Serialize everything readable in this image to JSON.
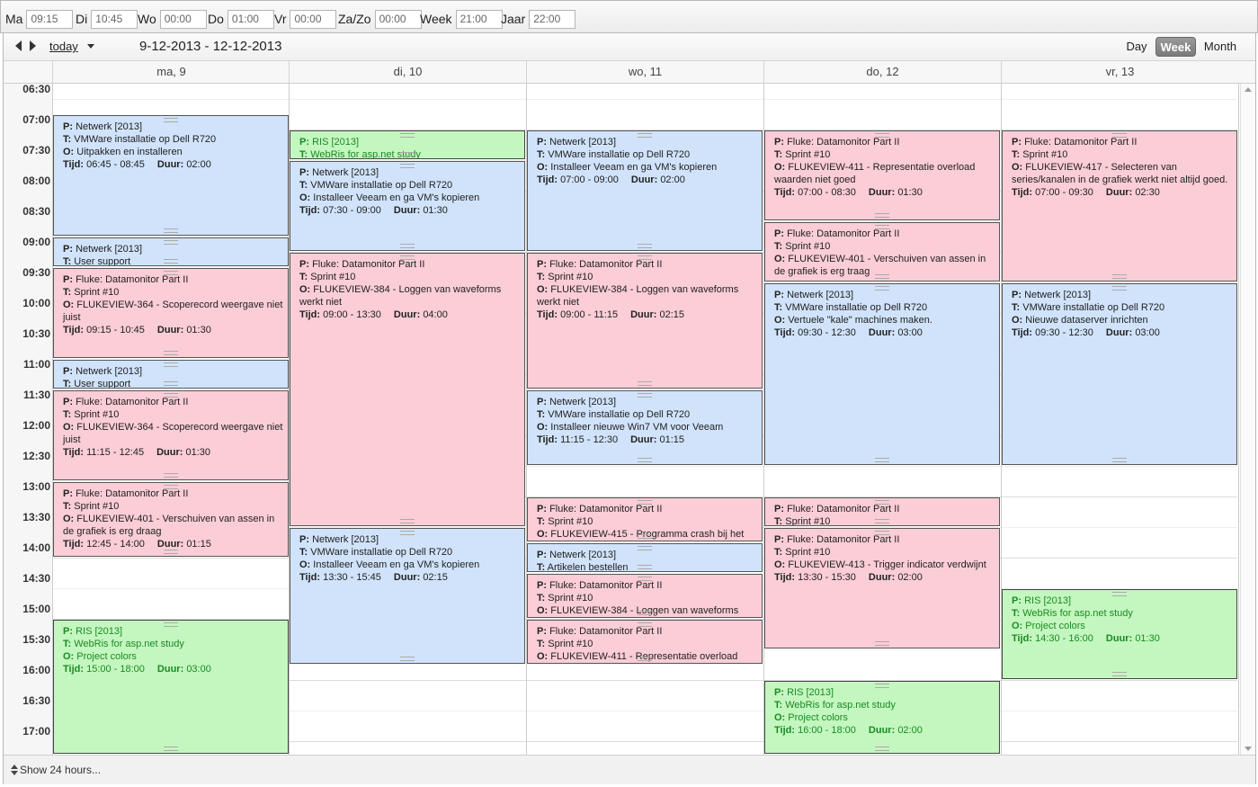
{
  "topbar": [
    {
      "label": "Ma",
      "value": "09:15"
    },
    {
      "label": "Di",
      "value": "10:45"
    },
    {
      "label": "Wo",
      "value": "00:00"
    },
    {
      "label": "Do",
      "value": "01:00"
    },
    {
      "label": "Vr",
      "value": "00:00"
    },
    {
      "label": "Za/Zo",
      "value": "00:00"
    },
    {
      "label": "Week",
      "value": "21:00"
    },
    {
      "label": "Jaar",
      "value": "22:00"
    }
  ],
  "nav": {
    "today": "today",
    "date_range": "9-12-2013 - 12-12-2013",
    "views": {
      "day": "Day",
      "week": "Week",
      "month": "Month"
    },
    "active_view": "Week"
  },
  "days": [
    "ma, 9",
    "di, 10",
    "wo, 11",
    "do, 12",
    "vr, 13"
  ],
  "times": [
    "06:30",
    "07:00",
    "07:30",
    "08:00",
    "08:30",
    "09:00",
    "09:30",
    "10:00",
    "10:30",
    "11:00",
    "11:30",
    "12:00",
    "12:30",
    "13:00",
    "13:30",
    "14:00",
    "14:30",
    "15:00",
    "15:30",
    "16:00",
    "16:30",
    "17:00"
  ],
  "events": [
    {
      "day": 0,
      "start": "06:45",
      "end": "08:45",
      "color": "blue",
      "lines": [
        [
          "P:",
          "Netwerk [2013]"
        ],
        [
          "T:",
          "VMWare installatie op Dell R720"
        ],
        [
          "O:",
          "Uitpakken en installeren"
        ],
        [
          "Tijd:",
          "06:45 - 08:45",
          "Duur:",
          "02:00"
        ]
      ]
    },
    {
      "day": 0,
      "start": "08:45",
      "end": "09:15",
      "color": "blue",
      "lines": [
        [
          "P:",
          "Netwerk [2013]"
        ],
        [
          "T:",
          "User support"
        ]
      ]
    },
    {
      "day": 0,
      "start": "09:15",
      "end": "10:45",
      "color": "pink",
      "lines": [
        [
          "P:",
          "Fluke: Datamonitor Part II"
        ],
        [
          "T:",
          "Sprint #10"
        ],
        [
          "O:",
          "FLUKEVIEW-364 - Scoperecord weergave niet juist"
        ],
        [
          "Tijd:",
          "09:15 - 10:45",
          "Duur:",
          "01:30"
        ]
      ]
    },
    {
      "day": 0,
      "start": "10:45",
      "end": "11:15",
      "color": "blue",
      "lines": [
        [
          "P:",
          "Netwerk [2013]"
        ],
        [
          "T:",
          "User support"
        ]
      ]
    },
    {
      "day": 0,
      "start": "11:15",
      "end": "12:45",
      "color": "pink",
      "lines": [
        [
          "P:",
          "Fluke: Datamonitor Part II"
        ],
        [
          "T:",
          "Sprint #10"
        ],
        [
          "O:",
          "FLUKEVIEW-364 - Scoperecord weergave niet juist"
        ],
        [
          "Tijd:",
          "11:15 - 12:45",
          "Duur:",
          "01:30"
        ]
      ]
    },
    {
      "day": 0,
      "start": "12:45",
      "end": "14:00",
      "color": "pink",
      "lines": [
        [
          "P:",
          "Fluke: Datamonitor Part II"
        ],
        [
          "T:",
          "Sprint #10"
        ],
        [
          "O:",
          "FLUKEVIEW-401 - Verschuiven van assen in de grafiek is erg draag"
        ],
        [
          "Tijd:",
          "12:45 - 14:00",
          "Duur:",
          "01:15"
        ]
      ]
    },
    {
      "day": 0,
      "start": "15:00",
      "end": "18:00",
      "color": "green",
      "lines": [
        [
          "P:",
          "RIS [2013]"
        ],
        [
          "T:",
          "WebRis for asp.net study"
        ],
        [
          "O:",
          "Project colors"
        ],
        [
          "Tijd:",
          "15:00 - 18:00",
          "Duur:",
          "03:00"
        ]
      ]
    },
    {
      "day": 1,
      "start": "07:00",
      "end": "07:30",
      "color": "green",
      "lines": [
        [
          "P:",
          "RIS [2013]"
        ],
        [
          "T:",
          "WebRis for asp.net study"
        ]
      ]
    },
    {
      "day": 1,
      "start": "07:30",
      "end": "09:00",
      "color": "blue",
      "lines": [
        [
          "P:",
          "Netwerk [2013]"
        ],
        [
          "T:",
          "VMWare installatie op Dell R720"
        ],
        [
          "O:",
          "Installeer Veeam en ga VM's kopieren"
        ],
        [
          "Tijd:",
          "07:30 - 09:00",
          "Duur:",
          "01:30"
        ]
      ]
    },
    {
      "day": 1,
      "start": "09:00",
      "end": "13:30",
      "color": "pink",
      "lines": [
        [
          "P:",
          "Fluke: Datamonitor Part II"
        ],
        [
          "T:",
          "Sprint #10"
        ],
        [
          "O:",
          "FLUKEVIEW-384 - Loggen van waveforms werkt niet"
        ],
        [
          "Tijd:",
          "09:00 - 13:30",
          "Duur:",
          "04:00"
        ]
      ]
    },
    {
      "day": 1,
      "start": "13:30",
      "end": "15:45",
      "color": "blue",
      "lines": [
        [
          "P:",
          "Netwerk [2013]"
        ],
        [
          "T:",
          "VMWare installatie op Dell R720"
        ],
        [
          "O:",
          "Installeer Veeam en ga VM's kopieren"
        ],
        [
          "Tijd:",
          "13:30 - 15:45",
          "Duur:",
          "02:15"
        ]
      ]
    },
    {
      "day": 2,
      "start": "07:00",
      "end": "09:00",
      "color": "blue",
      "lines": [
        [
          "P:",
          "Netwerk [2013]"
        ],
        [
          "T:",
          "VMWare installatie op Dell R720"
        ],
        [
          "O:",
          "Installeer Veeam en ga VM's kopieren"
        ],
        [
          "Tijd:",
          "07:00 - 09:00",
          "Duur:",
          "02:00"
        ]
      ]
    },
    {
      "day": 2,
      "start": "09:00",
      "end": "11:15",
      "color": "pink",
      "lines": [
        [
          "P:",
          "Fluke: Datamonitor Part II"
        ],
        [
          "T:",
          "Sprint #10"
        ],
        [
          "O:",
          "FLUKEVIEW-384 - Loggen van waveforms werkt niet"
        ],
        [
          "Tijd:",
          "09:00 - 11:15",
          "Duur:",
          "02:15"
        ]
      ]
    },
    {
      "day": 2,
      "start": "11:15",
      "end": "12:30",
      "color": "blue",
      "lines": [
        [
          "P:",
          "Netwerk [2013]"
        ],
        [
          "T:",
          "VMWare installatie op Dell R720"
        ],
        [
          "O:",
          "Installeer nieuwe Win7 VM voor Veeam"
        ],
        [
          "Tijd:",
          "11:15 - 12:30",
          "Duur:",
          "01:15"
        ]
      ]
    },
    {
      "day": 2,
      "start": "13:00",
      "end": "13:45",
      "color": "pink",
      "lines": [
        [
          "P:",
          "Fluke: Datamonitor Part II"
        ],
        [
          "T:",
          "Sprint #10"
        ],
        [
          "O:",
          "FLUKEVIEW-415 - Programma crash bij het"
        ]
      ]
    },
    {
      "day": 2,
      "start": "13:45",
      "end": "14:15",
      "color": "blue",
      "lines": [
        [
          "P:",
          "Netwerk [2013]"
        ],
        [
          "T:",
          "Artikelen bestellen"
        ]
      ]
    },
    {
      "day": 2,
      "start": "14:15",
      "end": "15:00",
      "color": "pink",
      "lines": [
        [
          "P:",
          "Fluke: Datamonitor Part II"
        ],
        [
          "T:",
          "Sprint #10"
        ],
        [
          "O:",
          "FLUKEVIEW-384 - Loggen van waveforms"
        ]
      ]
    },
    {
      "day": 2,
      "start": "15:00",
      "end": "15:45",
      "color": "pink",
      "lines": [
        [
          "P:",
          "Fluke: Datamonitor Part II"
        ],
        [
          "T:",
          "Sprint #10"
        ],
        [
          "O:",
          "FLUKEVIEW-411 - Representatie overload"
        ]
      ]
    },
    {
      "day": 3,
      "start": "07:00",
      "end": "08:30",
      "color": "pink",
      "lines": [
        [
          "P:",
          "Fluke: Datamonitor Part II"
        ],
        [
          "T:",
          "Sprint #10"
        ],
        [
          "O:",
          "FLUKEVIEW-411 - Representatie overload waarden niet goed"
        ],
        [
          "Tijd:",
          "07:00 - 08:30",
          "Duur:",
          "01:30"
        ]
      ]
    },
    {
      "day": 3,
      "start": "08:30",
      "end": "09:30",
      "color": "pink",
      "lines": [
        [
          "P:",
          "Fluke: Datamonitor Part II"
        ],
        [
          "T:",
          "Sprint #10"
        ],
        [
          "O:",
          "FLUKEVIEW-401 - Verschuiven van assen in de grafiek is erg traag"
        ]
      ]
    },
    {
      "day": 3,
      "start": "09:30",
      "end": "12:30",
      "color": "blue",
      "lines": [
        [
          "P:",
          "Netwerk [2013]"
        ],
        [
          "T:",
          "VMWare installatie op Dell R720"
        ],
        [
          "O:",
          "Vertuele \"kale\" machines maken."
        ],
        [
          "Tijd:",
          "09:30 - 12:30",
          "Duur:",
          "03:00"
        ]
      ]
    },
    {
      "day": 3,
      "start": "13:00",
      "end": "13:30",
      "color": "pink",
      "lines": [
        [
          "P:",
          "Fluke: Datamonitor Part II"
        ],
        [
          "T:",
          "Sprint #10"
        ]
      ]
    },
    {
      "day": 3,
      "start": "13:30",
      "end": "15:30",
      "color": "pink",
      "lines": [
        [
          "P:",
          "Fluke: Datamonitor Part II"
        ],
        [
          "T:",
          "Sprint #10"
        ],
        [
          "O:",
          "FLUKEVIEW-413 - Trigger indicator verdwijnt"
        ],
        [
          "Tijd:",
          "13:30 - 15:30",
          "Duur:",
          "02:00"
        ]
      ]
    },
    {
      "day": 3,
      "start": "16:00",
      "end": "18:00",
      "color": "green",
      "lines": [
        [
          "P:",
          "RIS [2013]"
        ],
        [
          "T:",
          "WebRis for asp.net study"
        ],
        [
          "O:",
          "Project colors"
        ],
        [
          "Tijd:",
          "16:00 - 18:00",
          "Duur:",
          "02:00"
        ]
      ]
    },
    {
      "day": 4,
      "start": "07:00",
      "end": "09:30",
      "color": "pink",
      "lines": [
        [
          "P:",
          "Fluke: Datamonitor Part II"
        ],
        [
          "T:",
          "Sprint #10"
        ],
        [
          "O:",
          "FLUKEVIEW-417 - Selecteren van series/kanalen in de grafiek werkt niet altijd goed."
        ],
        [
          "Tijd:",
          "07:00 - 09:30",
          "Duur:",
          "02:30"
        ]
      ]
    },
    {
      "day": 4,
      "start": "09:30",
      "end": "12:30",
      "color": "blue",
      "lines": [
        [
          "P:",
          "Netwerk [2013]"
        ],
        [
          "T:",
          "VMWare installatie op Dell R720"
        ],
        [
          "O:",
          "Nieuwe dataserver inrichten"
        ],
        [
          "Tijd:",
          "09:30 - 12:30",
          "Duur:",
          "03:00"
        ]
      ]
    },
    {
      "day": 4,
      "start": "14:30",
      "end": "16:00",
      "color": "green",
      "lines": [
        [
          "P:",
          "RIS [2013]"
        ],
        [
          "T:",
          "WebRis for asp.net study"
        ],
        [
          "O:",
          "Project colors"
        ],
        [
          "Tijd:",
          "14:30 - 16:00",
          "Duur:",
          "01:30"
        ]
      ]
    }
  ],
  "footer": {
    "show24": "Show 24 hours..."
  }
}
